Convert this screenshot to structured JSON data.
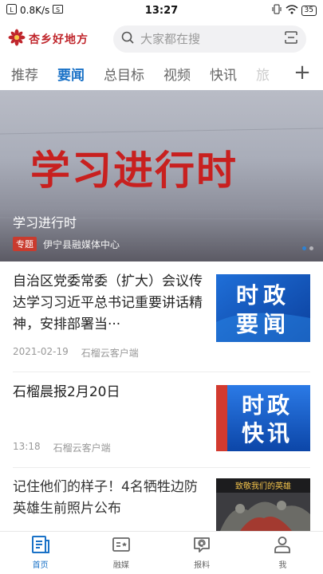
{
  "status_bar": {
    "network_speed": "0.8K/s",
    "time": "13:27",
    "battery": "35"
  },
  "header": {
    "brand_name": "杏乡好地方",
    "search_placeholder": "大家都在搜"
  },
  "tabs": [
    {
      "label": "推荐",
      "active": false
    },
    {
      "label": "要闻",
      "active": true
    },
    {
      "label": "总目标",
      "active": false
    },
    {
      "label": "视频",
      "active": false
    },
    {
      "label": "快讯",
      "active": false
    },
    {
      "label": "旅",
      "active": false
    }
  ],
  "hero": {
    "image_text": "学习进行时",
    "title": "学习进行时",
    "badge": "专题",
    "source": "伊宁县融媒体中心"
  },
  "news": [
    {
      "title": "自治区党委常委（扩大）会议传达学习习近平总书记重要讲话精神，安排部署当···",
      "date": "2021-02-19",
      "source": "石榴云客户端",
      "thumb_text_1": "时政",
      "thumb_text_2": "要闻"
    },
    {
      "title": "石榴晨报2月20日",
      "date": "13:18",
      "source": "石榴云客户端",
      "thumb_text_1": "时政",
      "thumb_text_2": "快讯"
    },
    {
      "title": "记住他们的样子！4名牺牲边防英雄生前照片公布",
      "thumb_text_1": "致敬我们的英雄"
    }
  ],
  "bottom_nav": [
    {
      "label": "首页",
      "icon": "home-doc-icon",
      "active": true
    },
    {
      "label": "融媒",
      "icon": "media-icon",
      "active": false
    },
    {
      "label": "报料",
      "icon": "report-icon",
      "active": false
    },
    {
      "label": "我",
      "icon": "person-icon",
      "active": false
    }
  ],
  "colors": {
    "accent": "#1a72c7",
    "brand": "#c0262c",
    "badge": "#c93b2e"
  }
}
